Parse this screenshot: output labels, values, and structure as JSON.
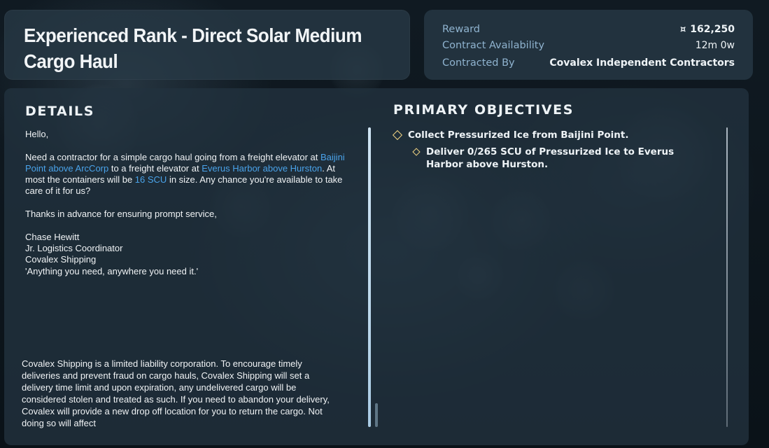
{
  "header": {
    "title": "Experienced Rank - Direct Solar Medium Cargo Haul"
  },
  "info": {
    "reward_label": "Reward",
    "reward_icon": "currency-icon",
    "reward_icon_glyph": "¤",
    "reward_value": "162,250",
    "availability_label": "Contract Availability",
    "availability_value": "12m 0w",
    "contracted_by_label": "Contracted By",
    "contracted_by_value": "Covalex Independent Contractors"
  },
  "details": {
    "heading": "DETAILS",
    "greeting": "Hello,",
    "body_1": "Need a contractor for a simple cargo haul going from a freight elevator at ",
    "link_1": "Baijini Point above ArcCorp",
    "body_2": " to a freight elevator at ",
    "link_2": "Everus Harbor above Hurston",
    "body_3": ". At most the containers will be ",
    "link_3": "16 SCU",
    "body_4": " in size. Any chance you're available to take care of it for us?",
    "thanks": "Thanks in advance for ensuring prompt service,",
    "signature": [
      "Chase Hewitt",
      "Jr. Logistics Coordinator",
      "Covalex Shipping",
      "'Anything you need, anywhere you need it.'"
    ],
    "disclaimer": "Covalex Shipping is a limited liability corporation. To encourage timely deliveries and prevent fraud on cargo hauls, Covalex Shipping will set a delivery time limit and upon expiration, any undelivered cargo will be considered stolen and treated as such. If you need to abandon your delivery, Covalex will provide a new drop off location for you to return the cargo. Not doing so will affect"
  },
  "objectives": {
    "heading": "PRIMARY OBJECTIVES",
    "items": [
      {
        "text": "Collect Pressurized Ice from Baijini Point."
      },
      {
        "text": "Deliver 0/265 SCU of Pressurized Ice to Everus Harbor above Hurston."
      }
    ]
  },
  "colors": {
    "accent_link": "#4aa3ea",
    "objective_marker": "#f1d483",
    "label": "#8fb3cf"
  }
}
